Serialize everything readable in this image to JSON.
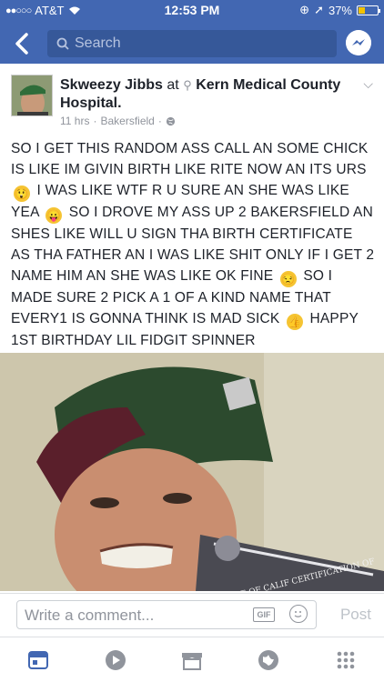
{
  "status": {
    "carrier": "AT&T",
    "time": "12:53 PM",
    "battery": "37%",
    "battery_fraction": 0.37
  },
  "nav": {
    "search_placeholder": "Search"
  },
  "post": {
    "author": "Skweezy Jibbs",
    "at_word": "at",
    "place": "Kern Medical County Hospital.",
    "time": "11 hrs",
    "location": "Bakersfield",
    "text_parts": [
      "SO I GET THIS RANDOM ASS CALL AN SOME CHICK IS LIKE IM GIVIN BIRTH LIKE RITE NOW AN ITS URS",
      "I WAS LIKE WTF R U SURE AN SHE WAS LIKE YEA",
      "SO I DROVE MY ASS UP 2 BAKERSFIELD AN SHES LIKE WILL U SIGN THA BIRTH CERTIFICATE AS THA FATHER AN I WAS LIKE SHIT ONLY IF I GET 2 NAME HIM AN SHE WAS LIKE OK FINE",
      "SO I MADE SURE 2 PICK A 1 OF A KIND NAME THAT EVERY1 IS GONNA THINK IS MAD SICK",
      "HAPPY 1ST BIRTHDAY LIL FIDGIT SPINNER"
    ],
    "emojis": [
      "astonished-face",
      "tongue-out-face",
      "unamused-face",
      "thumbs-up"
    ],
    "photo_caption": "STATE OF CALIF CERTIFICATION OF"
  },
  "comment": {
    "placeholder": "Write a comment...",
    "gif_label": "GIF",
    "post_label": "Post"
  },
  "tabs": [
    "news-feed-icon",
    "video-icon",
    "marketplace-icon",
    "globe-icon",
    "menu-grid-icon"
  ]
}
